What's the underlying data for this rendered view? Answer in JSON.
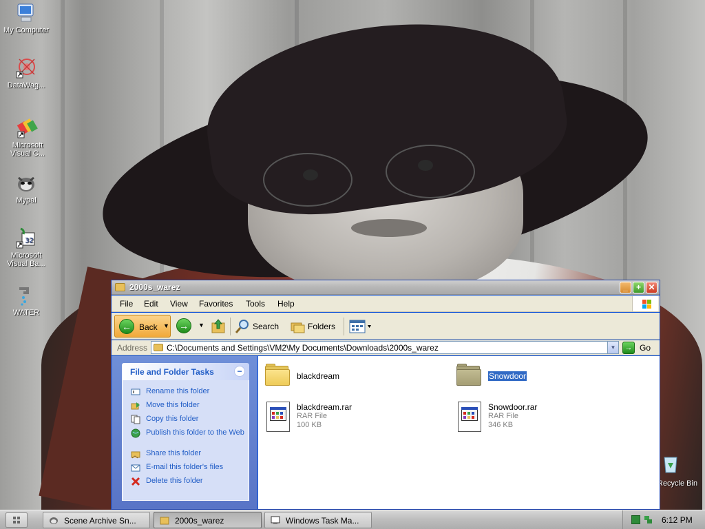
{
  "desktop": {
    "icons": [
      {
        "label": "My Computer",
        "icon": "my-computer-icon"
      },
      {
        "label": "DataWag...",
        "icon": "datawag-shortcut-icon"
      },
      {
        "label": "Microsoft Visual C...",
        "icon": "visual-c-shortcut-icon"
      },
      {
        "label": "Mypal",
        "icon": "mypal-icon"
      },
      {
        "label": "Microsoft Visual Ba...",
        "icon": "visual-basic-shortcut-icon"
      },
      {
        "label": "WATER",
        "icon": "water-icon"
      }
    ],
    "recycle_bin_label": "Recycle Bin"
  },
  "window": {
    "title": "2000s_warez",
    "menu": [
      "File",
      "Edit",
      "View",
      "Favorites",
      "Tools",
      "Help"
    ],
    "toolbar": {
      "back": "Back",
      "search": "Search",
      "folders": "Folders"
    },
    "address": {
      "label": "Address",
      "value": "C:\\Documents and Settings\\VM2\\My Documents\\Downloads\\2000s_warez",
      "go": "Go"
    },
    "tasks": {
      "header": "File and Folder Tasks",
      "collapse_symbol": "−",
      "items": [
        {
          "label": "Rename this folder",
          "icon": "rename-icon"
        },
        {
          "label": "Move this folder",
          "icon": "move-icon"
        },
        {
          "label": "Copy this folder",
          "icon": "copy-icon"
        },
        {
          "label": "Publish this folder to the Web",
          "icon": "publish-web-icon"
        },
        {
          "label": "Share this folder",
          "icon": "share-icon"
        },
        {
          "label": "E-mail this folder's files",
          "icon": "email-icon"
        },
        {
          "label": "Delete this folder",
          "icon": "delete-icon"
        }
      ]
    },
    "files": [
      {
        "name": "blackdream",
        "kind": "folder",
        "selected": false
      },
      {
        "name": "Snowdoor",
        "kind": "folder",
        "selected": true
      },
      {
        "name": "blackdream.rar",
        "kind": "rar",
        "type": "RAR File",
        "size": "100 KB"
      },
      {
        "name": "Snowdoor.rar",
        "kind": "rar",
        "type": "RAR File",
        "size": "346 KB"
      }
    ]
  },
  "taskbar": {
    "buttons": [
      {
        "label": "Scene Archive Sn...",
        "icon": "mypal-icon",
        "active": false
      },
      {
        "label": "2000s_warez",
        "icon": "folder-icon",
        "active": true
      },
      {
        "label": "Windows Task Ma...",
        "icon": "task-manager-icon",
        "active": false
      }
    ],
    "clock": "6:12 PM"
  },
  "colors": {
    "selection": "#316ac5",
    "task_link": "#215dc6",
    "task_pane": "#6f8fd8"
  }
}
